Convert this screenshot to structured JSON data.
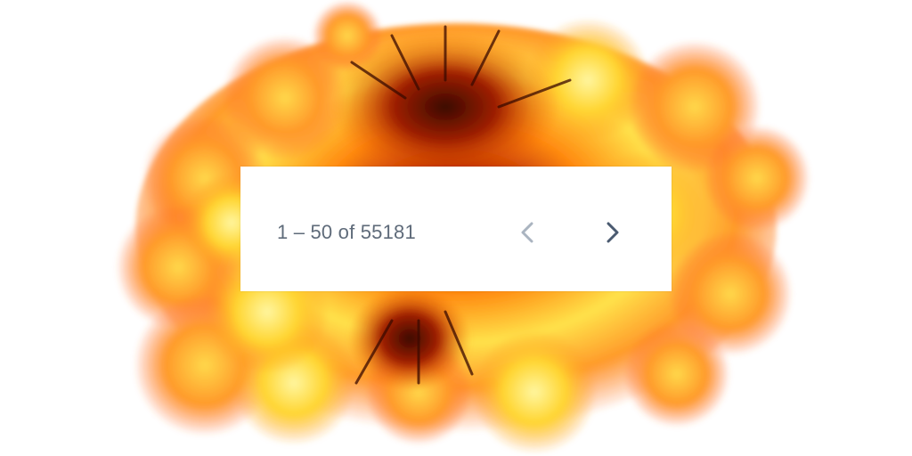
{
  "pagination": {
    "range_label": "1 – 50 of 55181",
    "prev_icon": "chevron-left-icon",
    "next_icon": "chevron-right-icon",
    "prev_disabled": true,
    "next_disabled": false
  },
  "colors": {
    "text": "#5f6b7a",
    "prev_icon": "#aab4c0",
    "next_icon": "#4a5a70",
    "fire_core": "#8a1a00",
    "fire_mid": "#ff7a10",
    "fire_light": "#ffe030"
  },
  "background": {
    "image": "explosion"
  }
}
